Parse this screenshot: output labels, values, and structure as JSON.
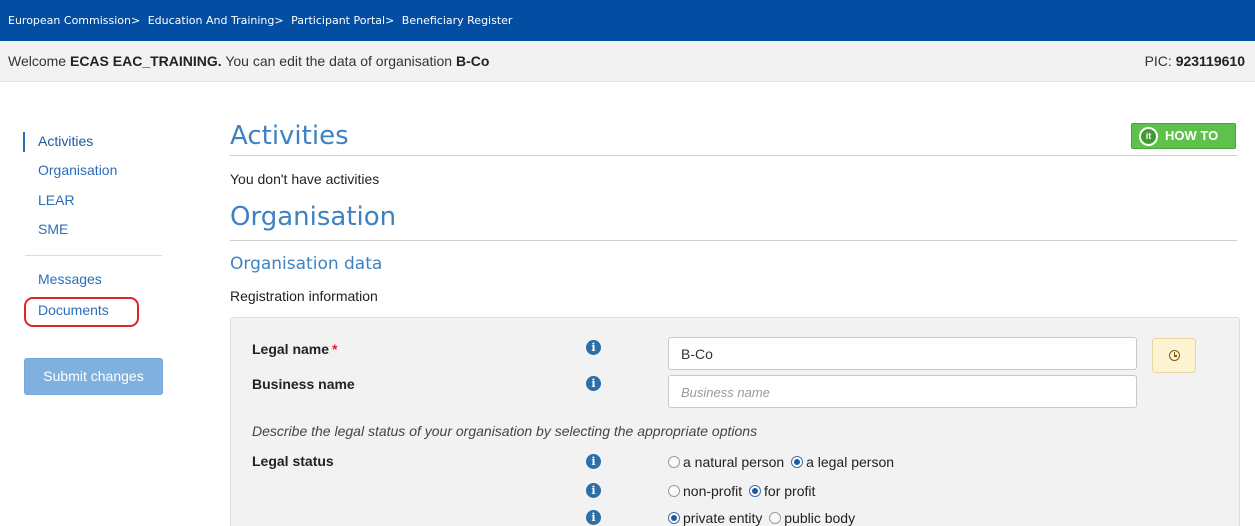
{
  "breadcrumb": {
    "items": [
      "European Commission",
      "Education And Training",
      "Participant Portal",
      "Beneficiary Register"
    ],
    "separator": ">"
  },
  "welcome": {
    "prefix": "Welcome",
    "user": "ECAS EAC_TRAINING.",
    "middle": "You can edit the data of organisation",
    "organisation": "B-Co",
    "pic_label": "PIC:",
    "pic_value": "923119610"
  },
  "sidebar": {
    "items": [
      {
        "label": "Activities"
      },
      {
        "label": "Organisation"
      },
      {
        "label": "LEAR"
      },
      {
        "label": "SME"
      },
      {
        "label": "Messages"
      },
      {
        "label": "Documents"
      }
    ],
    "submit_label": "Submit changes"
  },
  "activities": {
    "title": "Activities",
    "howto_label": "HOW TO",
    "howto_icon_text": "it",
    "empty_text": "You don't have activities"
  },
  "organisation": {
    "title": "Organisation",
    "subtitle": "Organisation data",
    "registration_text": "Registration information",
    "legal_name_label": "Legal name",
    "required_marker": "*",
    "legal_name_value": "B-Co",
    "business_name_label": "Business name",
    "business_name_placeholder": "Business name",
    "description": "Describe the legal status of your organisation by selecting the appropriate options",
    "legal_status_label": "Legal status",
    "info_glyph": "i",
    "status_options": [
      {
        "left": "a natural person",
        "right": "a legal person",
        "selected": "right"
      },
      {
        "left": "non-profit",
        "right": "for profit",
        "selected": "right"
      },
      {
        "left": "private entity",
        "right": "public body",
        "selected": "left"
      }
    ]
  }
}
